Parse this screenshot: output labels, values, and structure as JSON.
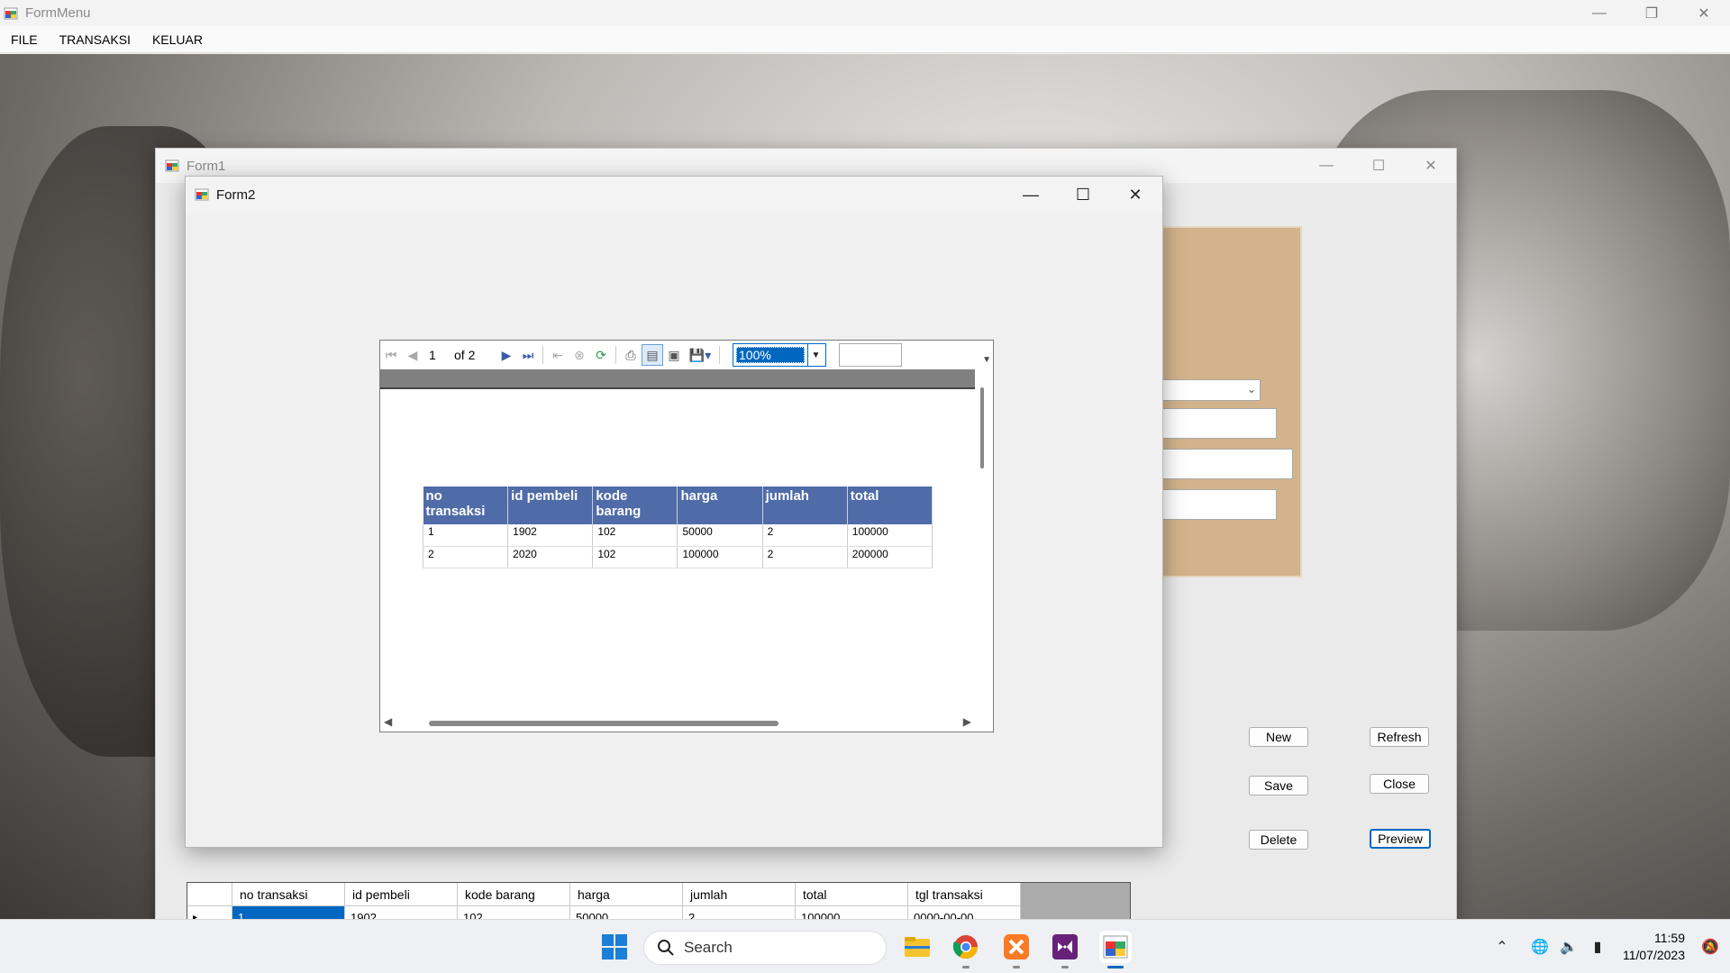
{
  "main_window": {
    "title": "FormMenu",
    "menu": [
      "FILE",
      "TRANSAKSI",
      "KELUAR"
    ]
  },
  "form1": {
    "title": "Form1",
    "buttons": {
      "new": "New",
      "refresh": "Refresh",
      "save": "Save",
      "close": "Close",
      "delete": "Delete",
      "preview": "Preview"
    },
    "grid": {
      "columns": [
        "no transaksi",
        "id pembeli",
        "kode barang",
        "harga",
        "jumlah",
        "total",
        "tgl transaksi"
      ],
      "first_row": [
        "1",
        "1902",
        "102",
        "50000",
        "2",
        "100000",
        "0000-00-00"
      ]
    }
  },
  "form2": {
    "title": "Form2",
    "report_viewer": {
      "current_page": "1",
      "page_of": "of 2",
      "zoom": "100%"
    },
    "report_table": {
      "headers": [
        "no transaksi",
        "id pembeli",
        "kode barang",
        "harga",
        "jumlah",
        "total"
      ],
      "rows": [
        [
          "1",
          "1902",
          "102",
          "50000",
          "2",
          "100000"
        ],
        [
          "2",
          "2020",
          "102",
          "100000",
          "2",
          "200000"
        ]
      ]
    }
  },
  "taskbar": {
    "search_label": "Search",
    "time": "11:59",
    "date": "11/07/2023"
  },
  "colors": {
    "accent": "#0067c0",
    "report_header": "#4f6ba8",
    "tan_panel": "#d3b38c"
  }
}
